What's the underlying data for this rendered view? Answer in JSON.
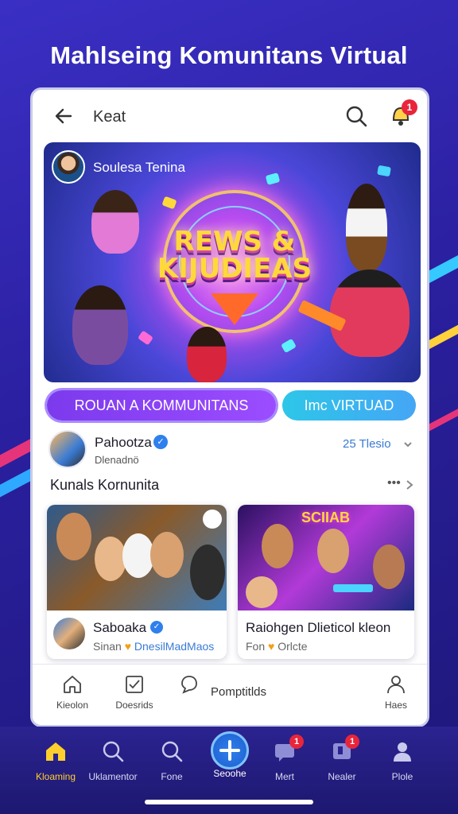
{
  "headline": "Mahlseing Komunitans Virtual",
  "topbar": {
    "title": "Keat",
    "notification_count": "1"
  },
  "hero": {
    "creator_name": "Soulesa Tenina",
    "logo_text": "REWS & KIJUDIEAS"
  },
  "pills": {
    "primary": "ROUAN A KOMMUNITANS",
    "secondary": "Imc VIRTUAD"
  },
  "post": {
    "name": "Pahootza",
    "handle": "Dlenadnö",
    "time": "25 Tlesio"
  },
  "section": {
    "title": "Kunals Kornunita",
    "more": "•••"
  },
  "cards": [
    {
      "title": "Saboaka",
      "sub_prefix": "Sinan",
      "sub_highlight": "DnesilMadMaos"
    },
    {
      "title": "Raiohgen Dlieticol kleon",
      "sub_prefix": "Fon",
      "sub_suffix": "Orlcte",
      "image_text": "SCIIAB"
    }
  ],
  "inner_nav": {
    "home": "Kieolon",
    "docs": "Doesrids",
    "posts": "Pomptitlds",
    "profile": "Haes"
  },
  "bottom_nav": {
    "items": [
      {
        "label": "Kloaming",
        "icon": "home-icon"
      },
      {
        "label": "Uklamentor",
        "icon": "search-icon"
      },
      {
        "label": "Fone",
        "icon": "search-icon"
      },
      {
        "label": "Seoohe",
        "icon": "add-icon"
      },
      {
        "label": "Mert",
        "icon": "chat-icon",
        "badge": "1"
      },
      {
        "label": "Nealer",
        "icon": "bookmark-icon",
        "badge": "1"
      },
      {
        "label": "Plole",
        "icon": "profile-icon"
      }
    ]
  },
  "colors": {
    "accent": "#7c3aed",
    "secondary": "#2dc6e8",
    "active_nav": "#ffcf2e",
    "badge": "#e8253b"
  }
}
